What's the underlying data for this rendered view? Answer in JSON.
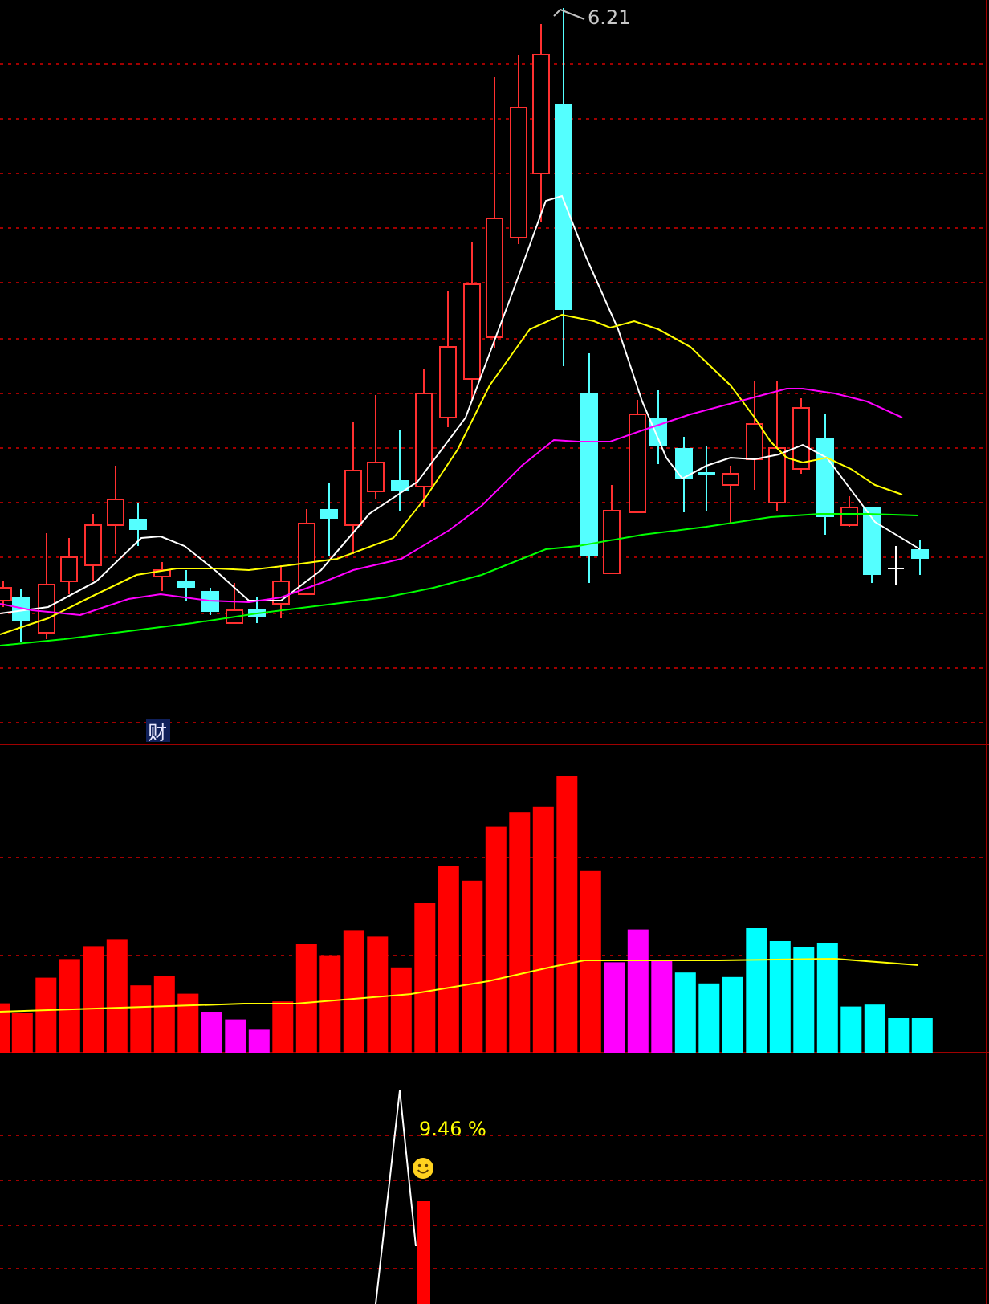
{
  "price_panel": {
    "high_label": "6.21",
    "info_badge": "财"
  },
  "indicator_panel": {
    "reading": "9.46 %"
  }
}
